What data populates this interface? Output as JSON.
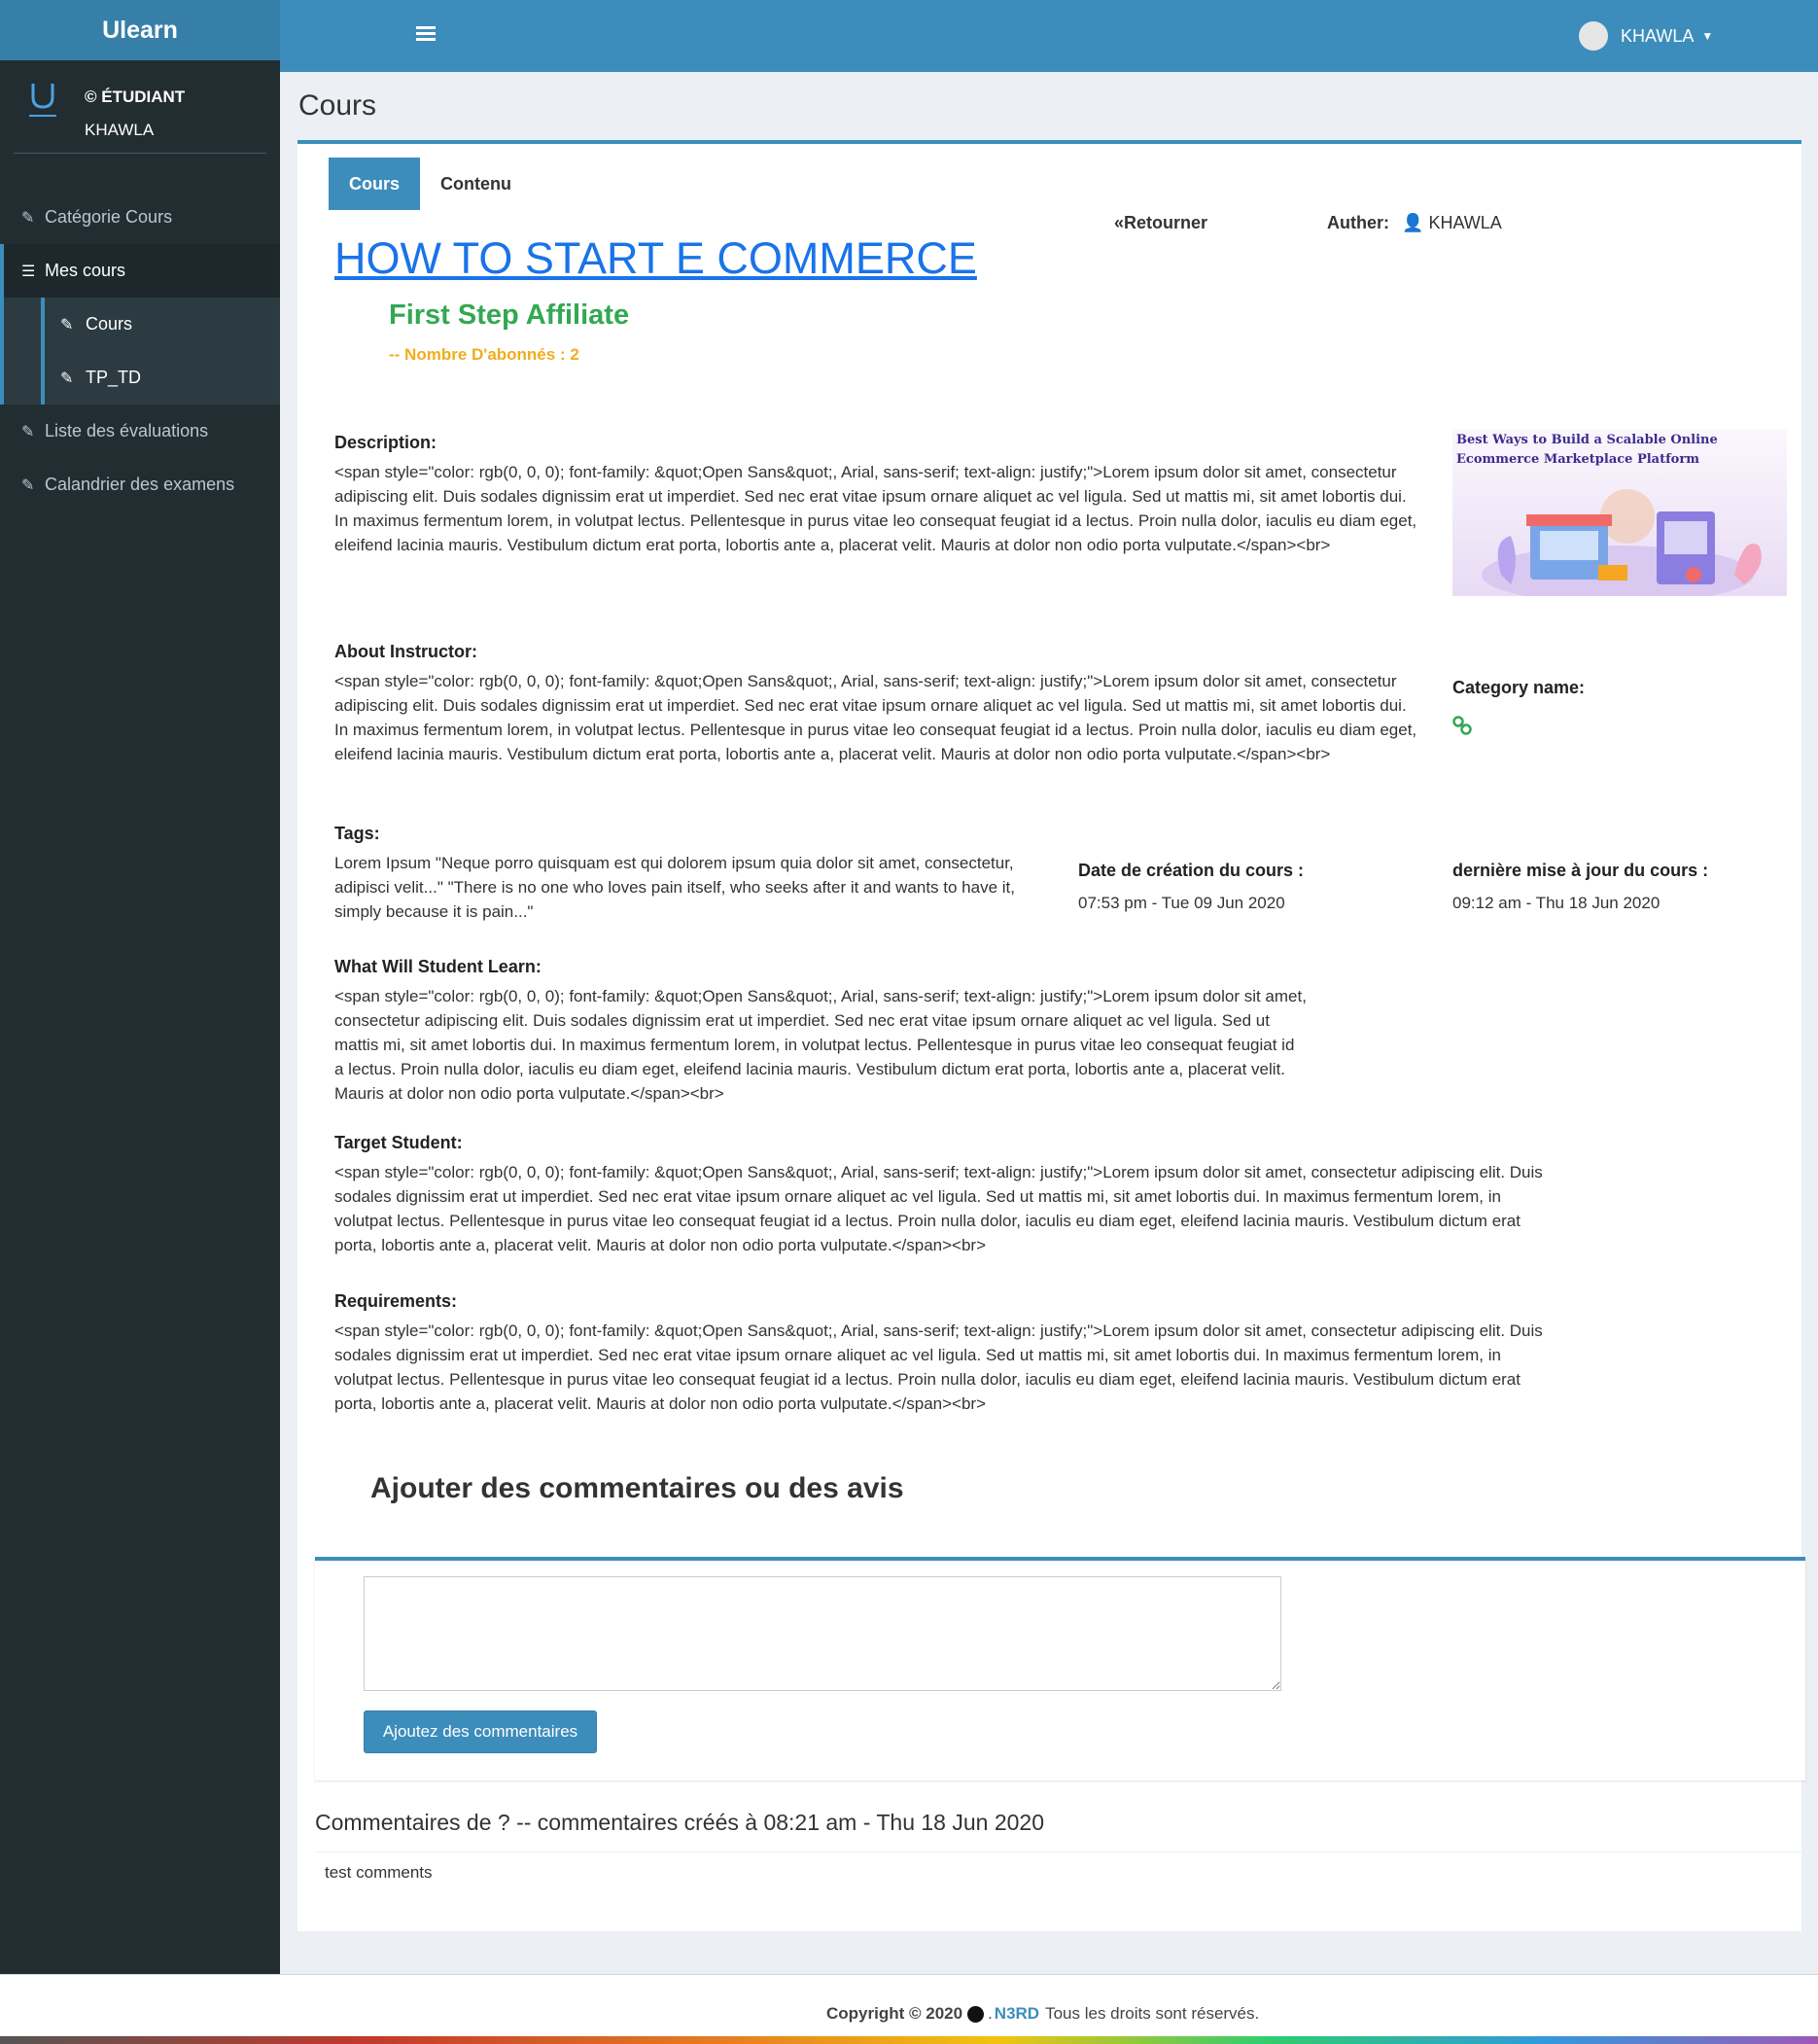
{
  "sidebar": {
    "brand": "Ulearn",
    "role": "© ÉTUDIANT",
    "username": "KHAWLA",
    "items": [
      {
        "label": "Catégorie Cours"
      },
      {
        "label": "Mes cours"
      },
      {
        "label": "Liste des évaluations"
      },
      {
        "label": "Calandrier des examens"
      }
    ],
    "subitems": [
      {
        "label": "Cours"
      },
      {
        "label": "TP_TD"
      }
    ]
  },
  "navbar": {
    "user": "KHAWLA"
  },
  "page": {
    "title": "Cours",
    "tabs": [
      {
        "label": "Cours"
      },
      {
        "label": "Contenu"
      }
    ],
    "back_label": "«Retourner",
    "author_label": "Auther:",
    "author_name": "KHAWLA"
  },
  "course": {
    "title": "HOW TO START E COMMERCE",
    "subtitle": "First Step Affiliate",
    "subscribers": "-- Nombre D'abonnés : 2",
    "image_caption": "Best Ways to Build a Scalable Online Ecommerce Marketplace Platform",
    "description_label": "Description:",
    "description": "<span style=\"color: rgb(0, 0, 0); font-family: &quot;Open Sans&quot;, Arial, sans-serif; text-align: justify;\">Lorem ipsum dolor sit amet, consectetur adipiscing elit. Duis sodales dignissim erat ut imperdiet. Sed nec erat vitae ipsum ornare aliquet ac vel ligula. Sed ut mattis mi, sit amet lobortis dui. In maximus fermentum lorem, in volutpat lectus. Pellentesque in purus vitae leo consequat feugiat id a lectus. Proin nulla dolor, iaculis eu diam eget, eleifend lacinia mauris. Vestibulum dictum erat porta, lobortis ante a, placerat velit. Mauris at dolor non odio porta vulputate.</span><br>",
    "instructor_label": "About Instructor:",
    "instructor": "<span style=\"color: rgb(0, 0, 0); font-family: &quot;Open Sans&quot;, Arial, sans-serif; text-align: justify;\">Lorem ipsum dolor sit amet, consectetur adipiscing elit. Duis sodales dignissim erat ut imperdiet. Sed nec erat vitae ipsum ornare aliquet ac vel ligula. Sed ut mattis mi, sit amet lobortis dui. In maximus fermentum lorem, in volutpat lectus. Pellentesque in purus vitae leo consequat feugiat id a lectus. Proin nulla dolor, iaculis eu diam eget, eleifend lacinia mauris. Vestibulum dictum erat porta, lobortis ante a, placerat velit. Mauris at dolor non odio porta vulputate.</span><br>",
    "category_label": "Category name:",
    "tags_label": "Tags:",
    "tags": "Lorem Ipsum \"Neque porro quisquam est qui dolorem ipsum quia dolor sit amet, consectetur, adipisci velit...\" \"There is no one who loves pain itself, who seeks after it and wants to have it, simply because it is pain...\"",
    "created_label": "Date de création du cours :",
    "created": "07:53 pm - Tue 09 Jun 2020",
    "updated_label": "dernière mise à jour du cours :",
    "updated": "09:12 am - Thu 18 Jun 2020",
    "learn_label": "What Will Student Learn:",
    "learn": "<span style=\"color: rgb(0, 0, 0); font-family: &quot;Open Sans&quot;, Arial, sans-serif; text-align: justify;\">Lorem ipsum dolor sit amet, consectetur adipiscing elit. Duis sodales dignissim erat ut imperdiet. Sed nec erat vitae ipsum ornare aliquet ac vel ligula. Sed ut mattis mi, sit amet lobortis dui. In maximus fermentum lorem, in volutpat lectus. Pellentesque in purus vitae leo consequat feugiat id a lectus. Proin nulla dolor, iaculis eu diam eget, eleifend lacinia mauris. Vestibulum dictum erat porta, lobortis ante a, placerat velit. Mauris at dolor non odio porta vulputate.</span><br>",
    "target_label": "Target Student:",
    "target": "<span style=\"color: rgb(0, 0, 0); font-family: &quot;Open Sans&quot;, Arial, sans-serif; text-align: justify;\">Lorem ipsum dolor sit amet, consectetur adipiscing elit. Duis sodales dignissim erat ut imperdiet. Sed nec erat vitae ipsum ornare aliquet ac vel ligula. Sed ut mattis mi, sit amet lobortis dui. In maximus fermentum lorem, in volutpat lectus. Pellentesque in purus vitae leo consequat feugiat id a lectus. Proin nulla dolor, iaculis eu diam eget, eleifend lacinia mauris. Vestibulum dictum erat porta, lobortis ante a, placerat velit. Mauris at dolor non odio porta vulputate.</span><br>",
    "requirements_label": "Requirements:",
    "requirements": "<span style=\"color: rgb(0, 0, 0); font-family: &quot;Open Sans&quot;, Arial, sans-serif; text-align: justify;\">Lorem ipsum dolor sit amet, consectetur adipiscing elit. Duis sodales dignissim erat ut imperdiet. Sed nec erat vitae ipsum ornare aliquet ac vel ligula. Sed ut mattis mi, sit amet lobortis dui. In maximus fermentum lorem, in volutpat lectus. Pellentesque in purus vitae leo consequat feugiat id a lectus. Proin nulla dolor, iaculis eu diam eget, eleifend lacinia mauris. Vestibulum dictum erat porta, lobortis ante a, placerat velit. Mauris at dolor non odio porta vulputate.</span><br>"
  },
  "comments": {
    "heading": "Ajouter des commentaires ou des avis",
    "textarea_value": "",
    "button_label": "Ajoutez des commentaires",
    "meta": "Commentaires de ? -- commentaires créés à 08:21 am - Thu 18 Jun 2020",
    "body": "test comments"
  },
  "footer": {
    "copyright": "Copyright © 2020",
    "brand": "N3RD",
    "rights": "Tous les droits sont réservés."
  },
  "icons": {
    "menu": "hamburger-icon",
    "sidebar": [
      "edit-icon",
      "list-icon",
      "edit-icon",
      "edit-icon",
      "edit-icon",
      "edit-icon"
    ],
    "author": "user-icon",
    "category": "link-icon"
  },
  "colors": {
    "primary": "#3c8dbc",
    "sidebar": "#222d32",
    "title_link": "#1a73e8",
    "subtitle": "#33a852",
    "subscribers": "#f0ad1e"
  }
}
